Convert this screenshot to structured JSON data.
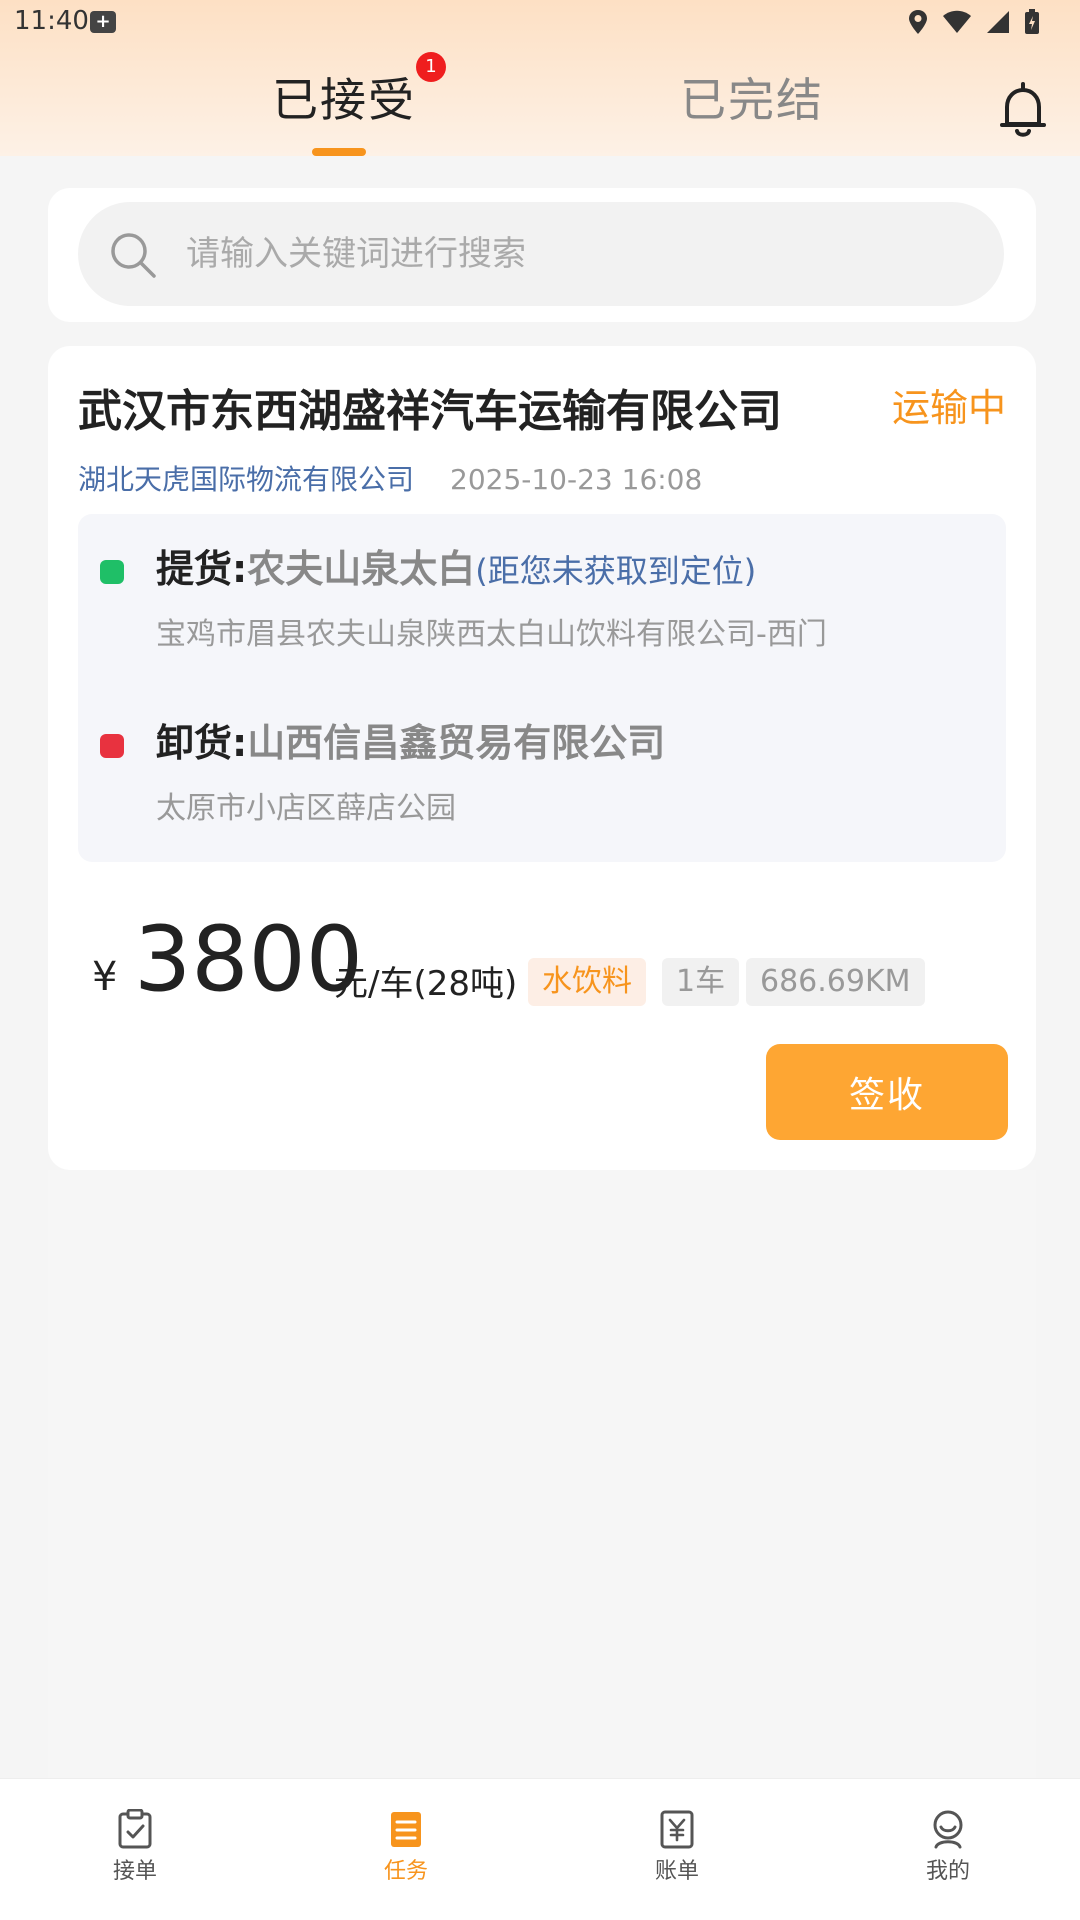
{
  "status_bar": {
    "time": "11:40",
    "notification_glyph": "+"
  },
  "tabs": {
    "accepted": "已接受",
    "completed": "已完结",
    "badge_count": "1",
    "active": "accepted"
  },
  "search": {
    "placeholder": "请输入关键词进行搜索",
    "value": ""
  },
  "order": {
    "company": "武汉市东西湖盛祥汽车运输有限公司",
    "status": "运输中",
    "shipper": "湖北天虎国际物流有限公司",
    "time": "2025-10-23 16:08",
    "pickup": {
      "label": "提货:",
      "place": "农夫山泉太白",
      "distance": "(距您未获取到定位)",
      "address": "宝鸡市眉县农夫山泉陕西太白山饮料有限公司-西门"
    },
    "delivery": {
      "label": "卸货:",
      "place": "山西信昌鑫贸易有限公司",
      "address": "太原市小店区薛店公园"
    },
    "price": {
      "currency": "¥",
      "value": "3800",
      "unit": "元/车(28吨)"
    },
    "tags": {
      "cargo": "水饮料",
      "cars": "1车",
      "distance": "686.69KM"
    },
    "action_label": "签收"
  },
  "bottom_nav": {
    "orders": "接单",
    "tasks": "任务",
    "bills": "账单",
    "mine": "我的",
    "active": "tasks"
  },
  "colors": {
    "accent": "#f7941d",
    "button": "#fea633",
    "pickup_dot": "#1fbf67",
    "delivery_dot": "#e8323f",
    "link_blue": "#4a6ea8"
  }
}
